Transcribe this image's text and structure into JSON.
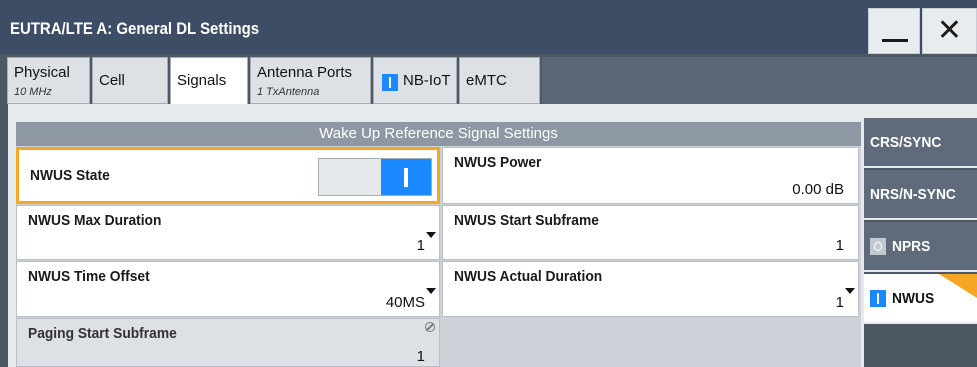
{
  "window": {
    "title": "EUTRA/LTE A: General DL Settings"
  },
  "tabs": [
    {
      "label": "Physical",
      "sub": "10 MHz"
    },
    {
      "label": "Cell"
    },
    {
      "label": "Signals"
    },
    {
      "label": "Antenna Ports",
      "sub": "1 TxAntenna"
    },
    {
      "label": "NB-IoT"
    },
    {
      "label": "eMTC"
    }
  ],
  "panel": {
    "title": "Wake Up Reference Signal Settings"
  },
  "fields": {
    "nwus_state": {
      "label": "NWUS State",
      "toggle": "on"
    },
    "nwus_power": {
      "label": "NWUS Power",
      "value": "0.00 dB"
    },
    "nwus_max_duration": {
      "label": "NWUS Max Duration",
      "value": "1"
    },
    "nwus_start_subframe": {
      "label": "NWUS Start Subframe",
      "value": "1"
    },
    "nwus_time_offset": {
      "label": "NWUS Time Offset",
      "value": "40MS"
    },
    "nwus_actual_duration": {
      "label": "NWUS Actual Duration",
      "value": "1"
    },
    "paging_start_subframe": {
      "label": "Paging Start Subframe",
      "value": "1"
    }
  },
  "side_tabs": [
    {
      "label": "CRS/SYNC"
    },
    {
      "label": "NRS/N-SYNC"
    },
    {
      "label": "NPRS",
      "state": "off"
    },
    {
      "label": "NWUS",
      "state": "on"
    }
  ],
  "colors": {
    "accent": "#1a88ff",
    "focus": "#f5a623",
    "titlebar": "#3d4d66"
  }
}
